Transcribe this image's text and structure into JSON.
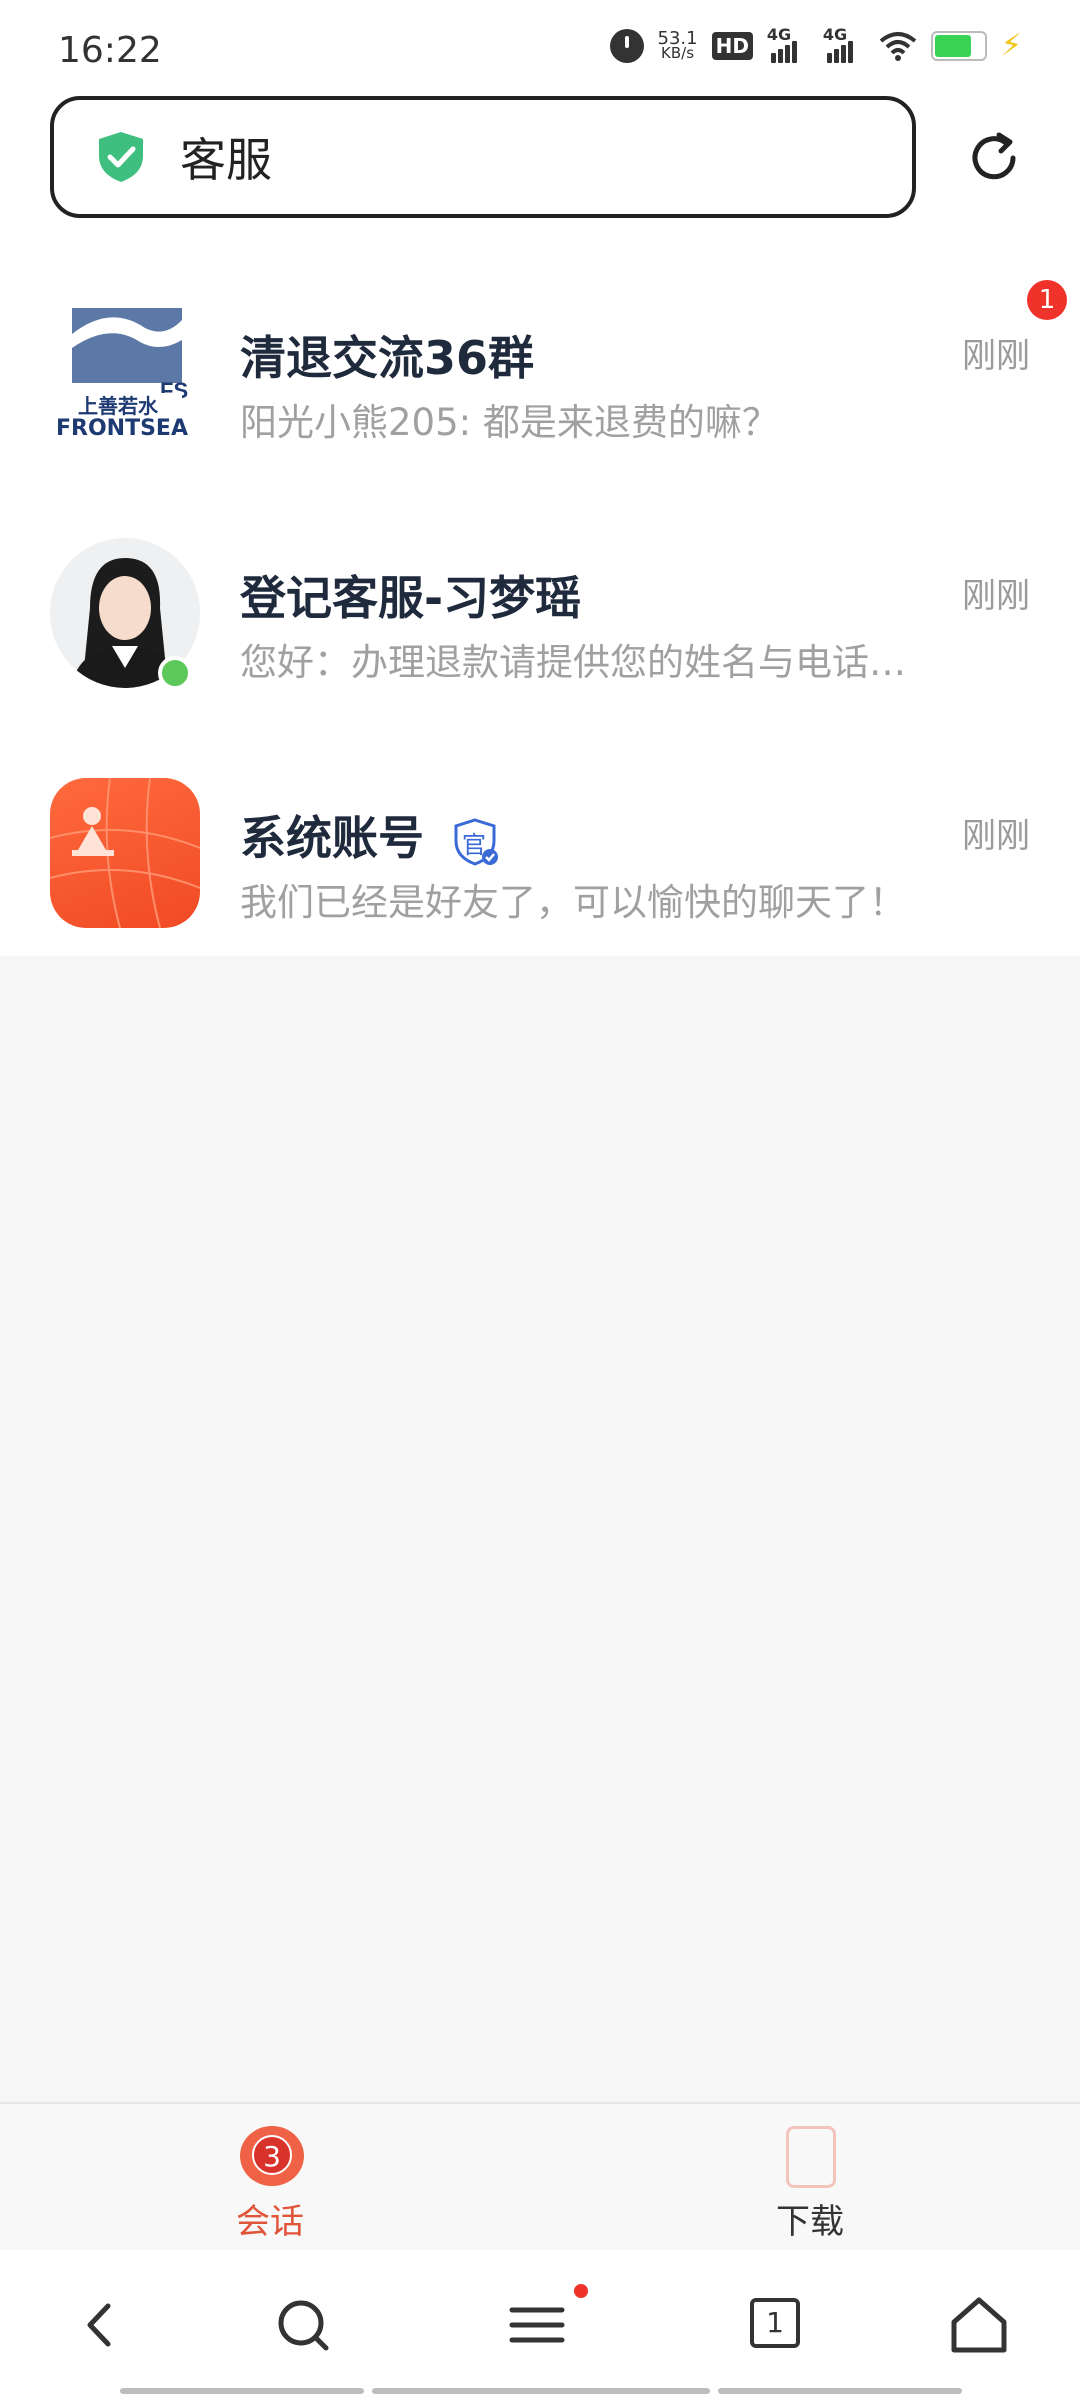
{
  "status_bar": {
    "time": "16:22",
    "speed_value": "53.1",
    "speed_unit": "KB/s",
    "hd_label": "HD",
    "network1": "4G",
    "network2": "4G"
  },
  "search": {
    "query": "客服"
  },
  "chats": [
    {
      "title": "清退交流36群",
      "time": "刚刚",
      "preview": "阳光小熊205: 都是来退费的嘛？",
      "unread": "1",
      "avatar_text1": "上善若水",
      "avatar_text2": "FRONTSEA"
    },
    {
      "title": "登记客服-习梦瑶",
      "time": "刚刚",
      "preview": "您好：办理退款请提供您的姓名与电话…",
      "online": true
    },
    {
      "title": "系统账号",
      "time": "刚刚",
      "preview": "我们已经是好友了，可以愉快的聊天了！",
      "official_label": "官"
    }
  ],
  "tabs": [
    {
      "label": "会话",
      "badge": "3",
      "color": "#e0553a",
      "active": true
    },
    {
      "label": "下载",
      "color": "#333333",
      "active": false
    }
  ],
  "nav": {
    "tab_count": "1"
  },
  "colors": {
    "accent": "#e0553a",
    "badge": "#f0332a",
    "online": "#5cc85a",
    "shield": "#3fbf7f"
  }
}
